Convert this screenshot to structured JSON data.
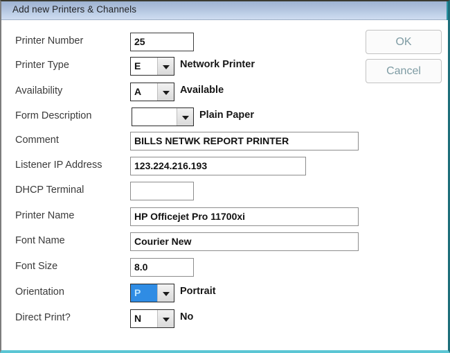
{
  "window": {
    "title": "Add new Printers & Channels",
    "accent_color": "#1f86ad",
    "title_bar_color": "#aec0db",
    "selection_color": "#2f8ce4",
    "button_text_color": "#7e9ba3",
    "bottom_border_color": "#5bc6d4"
  },
  "buttons": {
    "ok": "OK",
    "cancel": "Cancel"
  },
  "fields": [
    {
      "label": "Printer Number",
      "type": "text",
      "value": "25",
      "placeholder": "",
      "description": ""
    },
    {
      "label": "Printer Type",
      "type": "combo",
      "value": "E",
      "placeholder": "",
      "description": "Network Printer"
    },
    {
      "label": "Availability",
      "type": "combo",
      "value": "A",
      "placeholder": "",
      "description": "Available"
    },
    {
      "label": "Form Description",
      "type": "combo",
      "value": "",
      "placeholder": "",
      "description": "Plain Paper"
    },
    {
      "label": "Comment",
      "type": "text",
      "value": "BILLS NETWK REPORT PRINTER",
      "placeholder": "",
      "description": ""
    },
    {
      "label": "Listener IP Address",
      "type": "text",
      "value": "123.224.216.193",
      "placeholder": "",
      "description": ""
    },
    {
      "label": "DHCP Terminal",
      "type": "text",
      "value": "",
      "placeholder": "",
      "description": ""
    },
    {
      "label": "Printer Name",
      "type": "text",
      "value": "HP Officejet Pro 11700xi",
      "placeholder": "",
      "description": ""
    },
    {
      "label": "Font Name",
      "type": "text",
      "value": "Courier New",
      "placeholder": "",
      "description": ""
    },
    {
      "label": "Font Size",
      "type": "text",
      "value": "8.0",
      "placeholder": "",
      "description": ""
    },
    {
      "label": "Orientation",
      "type": "combo",
      "value": "P",
      "placeholder": "",
      "description": "Portrait",
      "selected": true
    },
    {
      "label": "Direct Print?",
      "type": "combo",
      "value": "N",
      "placeholder": "",
      "description": "No"
    }
  ]
}
